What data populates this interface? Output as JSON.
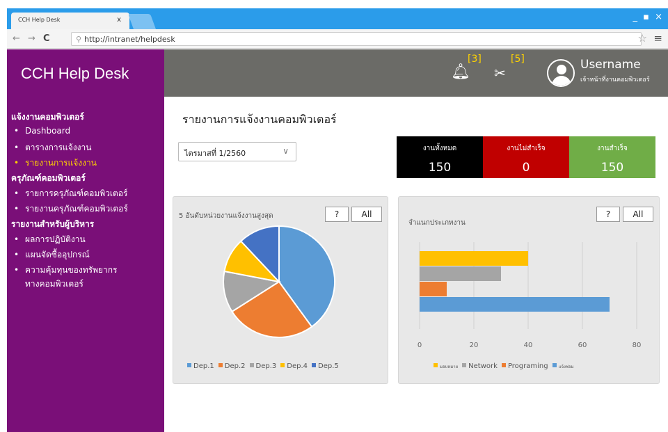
{
  "browser": {
    "tab_title": "CCH Help Desk",
    "tab_close": "x",
    "url": "http://intranet/helpdesk",
    "window_controls": "_ ▪ ×"
  },
  "sidebar": {
    "brand": "CCH Help Desk",
    "sections": [
      {
        "label": "แจ้งงานคอมพิวเตอร์",
        "items": [
          {
            "label": "Dashboard",
            "active": false
          },
          {
            "label": "ตารางการแจ้งงาน",
            "active": false
          },
          {
            "label": "รายงานการแจ้งงาน",
            "active": true
          }
        ]
      },
      {
        "label": "ครุภัณฑ์คอมพิวเตอร์",
        "items": [
          {
            "label": "รายการครุภัณฑ์คอมพิวเตอร์",
            "active": false
          },
          {
            "label": "รายงานครุภัณฑ์คอมพิวเตอร์",
            "active": false
          }
        ]
      },
      {
        "label": "รายงานสำหรับผู้บริหาร",
        "items": [
          {
            "label": "ผลการปฏิบัติงาน",
            "active": false
          },
          {
            "label": "แผนจัดซื้ออุปกรณ์",
            "active": false
          },
          {
            "label": "ความคุ้มทุนของทรัพยากร",
            "active": false
          },
          {
            "label": "ทางคอมพิวเตอร์",
            "active": false
          }
        ]
      }
    ]
  },
  "header": {
    "notifications_count": "[3]",
    "tools_count": "[5]",
    "username": "Username",
    "role": "เจ้าหน้าที่งานคอมพิวเตอร์"
  },
  "main": {
    "page_title": "รายงานการแจ้งงานคอมพิวเตอร์",
    "quarter_select": "ไตรมาสที่ 1/2560",
    "stats": [
      {
        "label": "งานทั้งหมด",
        "value": "150",
        "color": "#000000"
      },
      {
        "label": "งานไม่สำเร็จ",
        "value": "0",
        "color": "#c00000"
      },
      {
        "label": "งานสำเร็จ",
        "value": "150",
        "color": "#70ad47"
      }
    ],
    "help_button": "?",
    "all_button": "All",
    "pie_card_title": "5 อันดับหน่วยงานแจ้งงานสูงสุด",
    "bar_card_title": "จำแนกประเภทงาน"
  },
  "chart_data": [
    {
      "type": "pie",
      "title": "5 อันดับหน่วยงานแจ้งงานสูงสุด",
      "labels": [
        "Dep.1",
        "Dep.2",
        "Dep.3",
        "Dep.4",
        "Dep.5"
      ],
      "values": [
        40,
        26,
        12,
        10,
        12
      ],
      "colors": [
        "#5b9bd5",
        "#ed7d31",
        "#a5a5a5",
        "#ffc000",
        "#4472c4"
      ],
      "legend": "bottom"
    },
    {
      "type": "bar",
      "orientation": "horizontal",
      "title": "จำแนกประเภทงาน",
      "categories": [
        "มอบหมาย",
        "Network",
        "Programing",
        "แจ้งซ่อม"
      ],
      "values": [
        40,
        30,
        10,
        70
      ],
      "colors": [
        "#ffc000",
        "#a5a5a5",
        "#ed7d31",
        "#5b9bd5"
      ],
      "xlim": [
        0,
        80
      ],
      "xticks": [
        "0",
        "20",
        "40",
        "60",
        "80"
      ],
      "grid": true,
      "legend": "bottom"
    }
  ]
}
